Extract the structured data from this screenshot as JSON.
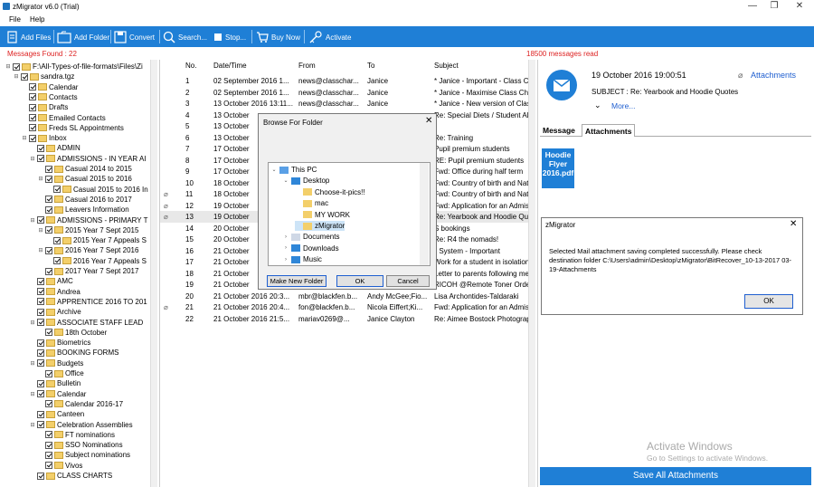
{
  "app": {
    "title": "zMigrator v6.0 (Trial)"
  },
  "menu": [
    "File",
    "Help"
  ],
  "toolbar": {
    "add_files": "Add Files",
    "add_folder": "Add Folder",
    "convert": "Convert",
    "search": "Search...",
    "stop": "Stop...",
    "buy_now": "Buy Now",
    "activate": "Activate"
  },
  "status": {
    "found": "Messages Found : 22",
    "total": "18500 messages read"
  },
  "tree": [
    {
      "label": "F:\\All-Types-of-file-formats\\Files\\Zi",
      "depth": 0,
      "toggle": "⊟",
      "folder": false
    },
    {
      "label": "sandra.tgz",
      "depth": 1,
      "toggle": "⊟"
    },
    {
      "label": "Calendar",
      "depth": 2,
      "toggle": ""
    },
    {
      "label": "Contacts",
      "depth": 2,
      "toggle": ""
    },
    {
      "label": "Drafts",
      "depth": 2,
      "toggle": ""
    },
    {
      "label": "Emailed Contacts",
      "depth": 2,
      "toggle": ""
    },
    {
      "label": "Freds  SL Appointments",
      "depth": 2,
      "toggle": ""
    },
    {
      "label": "Inbox",
      "depth": 2,
      "toggle": "⊟"
    },
    {
      "label": "ADMIN",
      "depth": 3,
      "toggle": ""
    },
    {
      "label": "ADMISSIONS - IN YEAR AI",
      "depth": 3,
      "toggle": "⊟"
    },
    {
      "label": "Casual 2014 to 2015",
      "depth": 4,
      "toggle": ""
    },
    {
      "label": "Casual 2015 to 2016",
      "depth": 4,
      "toggle": "⊟"
    },
    {
      "label": "Casual 2015 to 2016 In",
      "depth": 5,
      "toggle": ""
    },
    {
      "label": "Casual 2016 to 2017",
      "depth": 4,
      "toggle": ""
    },
    {
      "label": "Leavers Information",
      "depth": 4,
      "toggle": ""
    },
    {
      "label": "ADMISSIONS - PRIMARY T",
      "depth": 3,
      "toggle": "⊟"
    },
    {
      "label": "2015 Year 7 Sept 2015",
      "depth": 4,
      "toggle": "⊟"
    },
    {
      "label": "2015 Year 7 Appeals S",
      "depth": 5,
      "toggle": ""
    },
    {
      "label": "2016 Year 7 Sept 2016",
      "depth": 4,
      "toggle": "⊟"
    },
    {
      "label": "2016 Year 7 Appeals S",
      "depth": 5,
      "toggle": ""
    },
    {
      "label": "2017 Year 7 Sept 2017",
      "depth": 4,
      "toggle": ""
    },
    {
      "label": "AMC",
      "depth": 3,
      "toggle": ""
    },
    {
      "label": "Andrea",
      "depth": 3,
      "toggle": ""
    },
    {
      "label": "APPRENTICE 2016 TO 201",
      "depth": 3,
      "toggle": ""
    },
    {
      "label": "Archive",
      "depth": 3,
      "toggle": ""
    },
    {
      "label": "ASSOCIATE STAFF LEAD",
      "depth": 3,
      "toggle": "⊟"
    },
    {
      "label": "18th October",
      "depth": 4,
      "toggle": ""
    },
    {
      "label": "Biometrics",
      "depth": 3,
      "toggle": ""
    },
    {
      "label": "BOOKING FORMS",
      "depth": 3,
      "toggle": ""
    },
    {
      "label": "Budgets",
      "depth": 3,
      "toggle": "⊟"
    },
    {
      "label": "Office",
      "depth": 4,
      "toggle": ""
    },
    {
      "label": "Bulletin",
      "depth": 3,
      "toggle": ""
    },
    {
      "label": "Calendar",
      "depth": 3,
      "toggle": "⊟"
    },
    {
      "label": "Calendar 2016-17",
      "depth": 4,
      "toggle": ""
    },
    {
      "label": "Canteen",
      "depth": 3,
      "toggle": ""
    },
    {
      "label": "Celebration Assemblies",
      "depth": 3,
      "toggle": "⊟"
    },
    {
      "label": "FT nominations",
      "depth": 4,
      "toggle": ""
    },
    {
      "label": "SSO Nominations",
      "depth": 4,
      "toggle": ""
    },
    {
      "label": "Subject nominations",
      "depth": 4,
      "toggle": ""
    },
    {
      "label": "Vivos",
      "depth": 4,
      "toggle": ""
    },
    {
      "label": "CLASS CHARTS",
      "depth": 3,
      "toggle": ""
    }
  ],
  "grid": {
    "headers": [
      "No.",
      "Date/Time",
      "From",
      "To",
      "Subject"
    ],
    "rows": [
      {
        "no": "1",
        "date": "02 September 2016 1...",
        "from": "news@classchar...",
        "to": "Janice",
        "subject": "* Janice - Important - Class Ch",
        "att": false
      },
      {
        "no": "2",
        "date": "02 September 2016 1...",
        "from": "news@classchar...",
        "to": "Janice",
        "subject": "* Janice - Maximise Class Charts",
        "att": false
      },
      {
        "no": "3",
        "date": "13 October 2016 13:11...",
        "from": "news@classchar...",
        "to": "Janice",
        "subject": "* Janice - New version of Class C",
        "att": false
      },
      {
        "no": "4",
        "date": "13 October",
        "from": "",
        "to": "",
        "subject": "Re: Special Diets / Student Alle",
        "att": false
      },
      {
        "no": "5",
        "date": "13 October",
        "from": "",
        "to": "",
        "subject": "",
        "att": false
      },
      {
        "no": "6",
        "date": "13 October",
        "from": "",
        "to": "",
        "subject": "Re: Training",
        "att": false
      },
      {
        "no": "7",
        "date": "17 October",
        "from": "",
        "to": "",
        "subject": "Pupil premium students",
        "att": false
      },
      {
        "no": "8",
        "date": "17 October",
        "from": "",
        "to": "",
        "subject": "RE: Pupil premium students",
        "att": false
      },
      {
        "no": "9",
        "date": "17 October",
        "from": "",
        "to": "",
        "subject": "Fwd: Office during half term",
        "att": false
      },
      {
        "no": "10",
        "date": "18 October",
        "from": "",
        "to": "",
        "subject": "Fwd: Country of birth and Natic",
        "att": false
      },
      {
        "no": "11",
        "date": "18 October",
        "from": "",
        "to": "",
        "subject": "Fwd: Country of birth and Natic",
        "att": true
      },
      {
        "no": "12",
        "date": "19 October",
        "from": "",
        "to": "",
        "subject": "Fwd: Application for an Admissi",
        "att": true
      },
      {
        "no": "13",
        "date": "19 October",
        "from": "",
        "to": "",
        "subject": "Re: Yearbook and Hoodie Quote",
        "att": true,
        "sel": true
      },
      {
        "no": "14",
        "date": "20 October",
        "from": "",
        "to": "",
        "subject": "S bookings",
        "att": false
      },
      {
        "no": "15",
        "date": "20 October",
        "from": "",
        "to": "",
        "subject": "Re: R4 the nomads!",
        "att": false
      },
      {
        "no": "16",
        "date": "21 October",
        "from": "",
        "to": "",
        "subject": "* System - Important",
        "att": false
      },
      {
        "no": "17",
        "date": "21 October",
        "from": "",
        "to": "",
        "subject": "Work for a student  in isolation",
        "att": false
      },
      {
        "no": "18",
        "date": "21 October",
        "from": "",
        "to": "",
        "subject": "Letter to parents following me",
        "att": false
      },
      {
        "no": "19",
        "date": "21 October",
        "from": "",
        "to": "",
        "subject": "RICOH @Remote Toner Order",
        "att": false
      },
      {
        "no": "20",
        "date": "21 October 2016 20:3...",
        "from": "mbr@blackfen.b...",
        "to": "Andy McGee;Fio...",
        "subject": "Lisa Archontides-Taldaraki",
        "att": false
      },
      {
        "no": "21",
        "date": "21 October 2016 20:4...",
        "from": "fon@blackfen.b...",
        "to": "Nicola Eiffert;Ki...",
        "subject": "Fwd: Application for an Admissi",
        "att": true
      },
      {
        "no": "22",
        "date": "21 October 2016 21:5...",
        "from": "mariav0269@...",
        "to": "Janice Clayton",
        "subject": "Re: Aimee Bostock Photograph",
        "att": false
      }
    ]
  },
  "preview": {
    "date": "19 October 2016 19:00:51",
    "attachments_link": "Attachments",
    "subject": "SUBJECT : Re: Yearbook and Hoodie Quotes",
    "more": "More...",
    "tabs": [
      "Message",
      "Attachments"
    ],
    "attachment_name": "Hoodie Flyer 2016.pdf",
    "save_all": "Save All  Attachments"
  },
  "browse_dialog": {
    "title": "Browse For Folder",
    "items": [
      {
        "label": "This PC",
        "depth": 0,
        "toggle": "⌄",
        "icon": "pc"
      },
      {
        "label": "Desktop",
        "depth": 1,
        "toggle": "⌄",
        "icon": "desktop"
      },
      {
        "label": "Choose-it-pics!!",
        "depth": 2,
        "toggle": "",
        "icon": "folder"
      },
      {
        "label": "mac",
        "depth": 2,
        "toggle": "",
        "icon": "folder"
      },
      {
        "label": "MY WORK",
        "depth": 2,
        "toggle": "",
        "icon": "folder"
      },
      {
        "label": "zMigrator",
        "depth": 2,
        "toggle": "",
        "icon": "folder",
        "sel": true
      },
      {
        "label": "Documents",
        "depth": 1,
        "toggle": "›",
        "icon": "docs"
      },
      {
        "label": "Downloads",
        "depth": 1,
        "toggle": "›",
        "icon": "down"
      },
      {
        "label": "Music",
        "depth": 1,
        "toggle": "›",
        "icon": "music"
      }
    ],
    "make_new_folder": "Make New Folder",
    "ok": "OK",
    "cancel": "Cancel"
  },
  "msg_dialog": {
    "title": "zMigrator",
    "message": "Selected Mail attachment saving completed successfully. Please check destination folder C:\\Users\\admin\\Desktop\\zMigrator\\BitRecover_10-13-2017 03-19-Attachments",
    "ok": "OK"
  },
  "watermark": {
    "line1": "Activate Windows",
    "line2": "Go to Settings to activate Windows."
  }
}
